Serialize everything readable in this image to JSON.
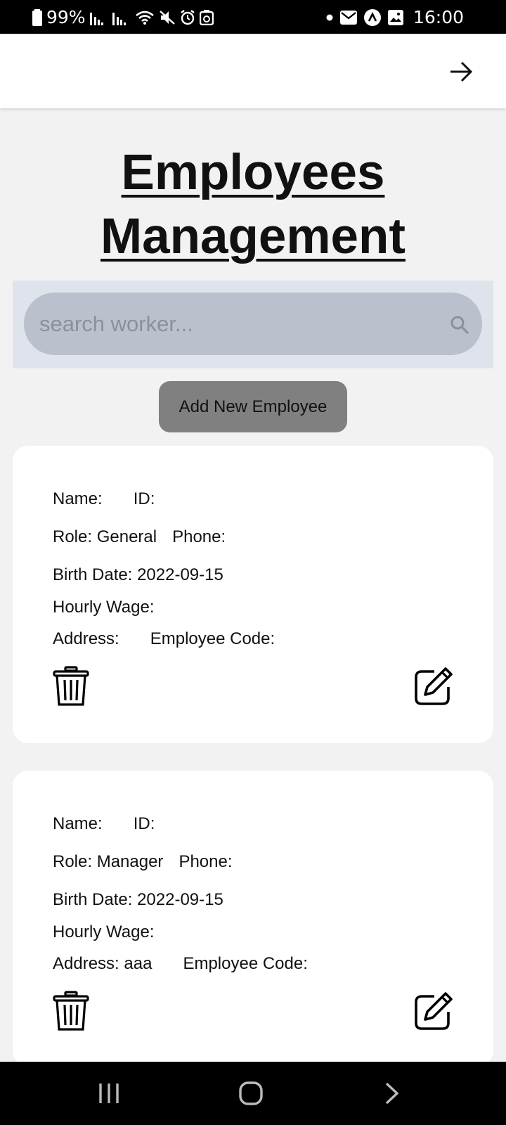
{
  "status_bar": {
    "battery": "99%",
    "time": "16:00"
  },
  "header": {
    "forward_icon": "arrow-right-icon"
  },
  "page": {
    "title_line1": "Employees",
    "title_line2": "Management"
  },
  "search": {
    "placeholder": "search worker...",
    "value": ""
  },
  "actions": {
    "add_label": "Add New Employee"
  },
  "labels": {
    "name": "Name:",
    "id": "ID:",
    "role": "Role:",
    "phone": "Phone:",
    "birth_date": "Birth Date:",
    "hourly_wage": "Hourly Wage:",
    "address": "Address:",
    "employee_code": "Employee Code:"
  },
  "employees": [
    {
      "name": "",
      "id": "",
      "role": "General",
      "phone": "",
      "birth_date": "2022-09-15",
      "hourly_wage": "",
      "address": "",
      "employee_code": ""
    },
    {
      "name": "",
      "id": "",
      "role": "Manager",
      "phone": "",
      "birth_date": "2022-09-15",
      "hourly_wage": "",
      "address": "aaa",
      "employee_code": ""
    }
  ],
  "icons": {
    "delete": "trash-icon",
    "edit": "edit-icon",
    "search": "search-icon"
  },
  "colors": {
    "add_button": "#808080",
    "search_box": "#bac1cc",
    "search_panel": "#dfe4ec"
  }
}
